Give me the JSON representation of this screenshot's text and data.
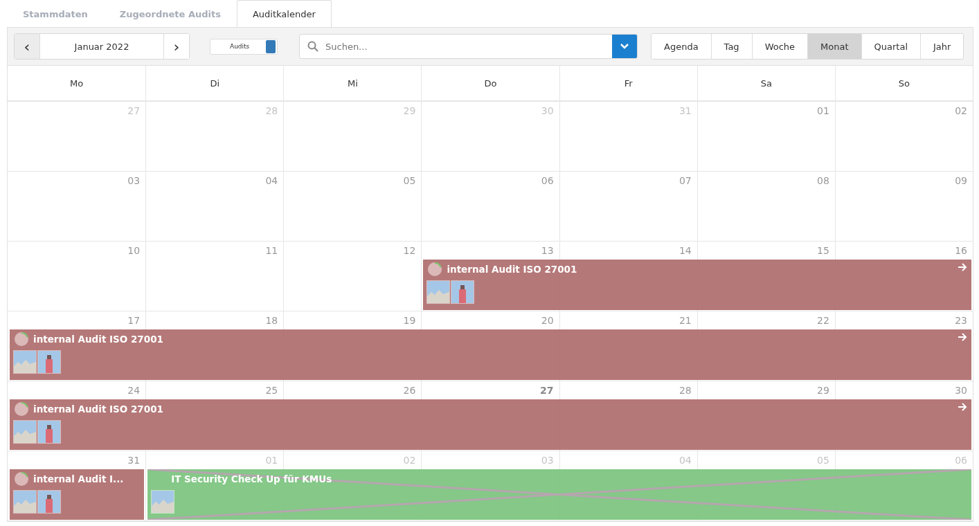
{
  "tabs": [
    {
      "label": "Stammdaten",
      "selected": false
    },
    {
      "label": "Zugeordnete Audits",
      "selected": false
    },
    {
      "label": "Auditkalender",
      "selected": true
    }
  ],
  "toolbar": {
    "prev": "‹",
    "month": "Januar 2022",
    "next": "›",
    "toggle": {
      "label": "Audits",
      "on": true
    },
    "search": {
      "placeholder": "Suchen..."
    }
  },
  "views": [
    {
      "label": "Agenda",
      "selected": false
    },
    {
      "label": "Tag",
      "selected": false
    },
    {
      "label": "Woche",
      "selected": false
    },
    {
      "label": "Monat",
      "selected": true
    },
    {
      "label": "Quartal",
      "selected": false
    },
    {
      "label": "Jahr",
      "selected": false
    }
  ],
  "weekdays": [
    "Mo",
    "Di",
    "Mi",
    "Do",
    "Fr",
    "Sa",
    "So"
  ],
  "weeks": [
    {
      "days": [
        {
          "number": "27",
          "outside": true
        },
        {
          "number": "28",
          "outside": true
        },
        {
          "number": "29",
          "outside": true
        },
        {
          "number": "30",
          "outside": true
        },
        {
          "number": "31",
          "outside": true
        },
        {
          "number": "01",
          "outside": false
        },
        {
          "number": "02",
          "outside": false
        }
      ]
    },
    {
      "days": [
        {
          "number": "03",
          "outside": false
        },
        {
          "number": "04",
          "outside": false
        },
        {
          "number": "05",
          "outside": false
        },
        {
          "number": "06",
          "outside": false
        },
        {
          "number": "07",
          "outside": false
        },
        {
          "number": "08",
          "outside": false
        },
        {
          "number": "09",
          "outside": false
        }
      ]
    },
    {
      "days": [
        {
          "number": "10",
          "outside": false
        },
        {
          "number": "11",
          "outside": false
        },
        {
          "number": "12",
          "outside": false
        },
        {
          "number": "13",
          "outside": false,
          "event": {
            "title": "internal Audit ISO 27001",
            "color": "#b06e6e",
            "level": 0.2,
            "continues": true,
            "crossed_out": false,
            "photos": [
              {
                "kind": "rocks"
              },
              {
                "kind": "tower"
              }
            ]
          }
        },
        {
          "number": "14",
          "outside": false
        },
        {
          "number": "15",
          "outside": false
        },
        {
          "number": "16",
          "outside": false
        }
      ]
    },
    {
      "days": [
        {
          "number": "17",
          "outside": false,
          "event": {
            "title": "internal Audit ISO 27001",
            "color": "#b06e6e",
            "level": 0.2,
            "continues": true,
            "crossed_out": false,
            "photos": [
              {
                "kind": "rocks"
              },
              {
                "kind": "tower"
              }
            ]
          }
        },
        {
          "number": "18",
          "outside": false
        },
        {
          "number": "19",
          "outside": false
        },
        {
          "number": "20",
          "outside": false
        },
        {
          "number": "21",
          "outside": false
        },
        {
          "number": "22",
          "outside": false
        },
        {
          "number": "23",
          "outside": false
        }
      ]
    },
    {
      "days": [
        {
          "number": "24",
          "outside": false,
          "event": {
            "title": "internal Audit ISO 27001",
            "color": "#b06e6e",
            "level": 0.2,
            "continues": true,
            "crossed_out": false,
            "photos": [
              {
                "kind": "rocks"
              },
              {
                "kind": "tower"
              }
            ]
          }
        },
        {
          "number": "25",
          "outside": false
        },
        {
          "number": "26",
          "outside": false
        },
        {
          "number": "27",
          "outside": false,
          "today": true
        },
        {
          "number": "28",
          "outside": false
        },
        {
          "number": "29",
          "outside": false
        },
        {
          "number": "30",
          "outside": false
        }
      ]
    },
    {
      "days": [
        {
          "number": "31",
          "outside": false,
          "event": {
            "title": "internal Audit I...",
            "color": "#b06e6e",
            "level": 0.2,
            "continues": false,
            "crossed_out": false,
            "photos": [
              {
                "kind": "rocks"
              },
              {
                "kind": "tower"
              }
            ]
          }
        },
        {
          "number": "01",
          "outside": true,
          "event": {
            "title": "IT Security Check Up für KMUs",
            "color": "#7cc47f",
            "continues": false,
            "crossed_out": true,
            "photos": [
              {
                "kind": "rocks"
              }
            ]
          }
        },
        {
          "number": "02",
          "outside": true
        },
        {
          "number": "03",
          "outside": true
        },
        {
          "number": "04",
          "outside": true
        },
        {
          "number": "05",
          "outside": true
        },
        {
          "number": "06",
          "outside": true
        }
      ]
    }
  ]
}
